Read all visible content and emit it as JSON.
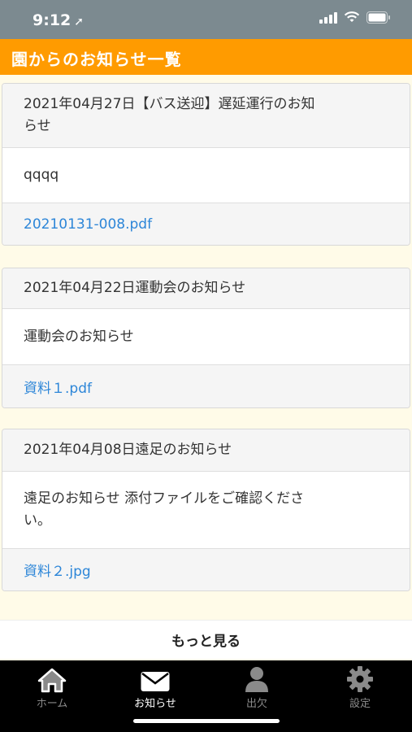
{
  "status_bar": {
    "time": "9:12",
    "location_arrow": "➚"
  },
  "header": {
    "title": "園からのお知らせ一覧"
  },
  "notices": [
    {
      "title_line1": "2021年04月27日【バス送迎】遅延運行のお知",
      "title_line2": "らせ",
      "body_line1": "qqqq",
      "body_line2": "",
      "attachment": "20210131-008.pdf"
    },
    {
      "title_line1": "2021年04月22日運動会のお知らせ",
      "title_line2": "",
      "body_line1": "運動会のお知らせ",
      "body_line2": "",
      "attachment": "資料１.pdf"
    },
    {
      "title_line1": "2021年04月08日遠足のお知らせ",
      "title_line2": "",
      "body_line1": "遠足のお知らせ 添付ファイルをご確認くださ",
      "body_line2": "い。",
      "attachment": "資料２.jpg"
    }
  ],
  "more_button": {
    "label": "もっと見る"
  },
  "tabbar": {
    "items": [
      {
        "label": "ホーム",
        "icon": "home-icon",
        "active": false
      },
      {
        "label": "お知らせ",
        "icon": "envelope-icon",
        "active": true
      },
      {
        "label": "出欠",
        "icon": "person-icon",
        "active": false
      },
      {
        "label": "設定",
        "icon": "gear-icon",
        "active": false
      }
    ]
  },
  "colors": {
    "header": "#ff9b00",
    "status_bar": "#7c8a90",
    "link": "#2d86d8",
    "background": "#fffbe8",
    "tabbar": "#000000"
  }
}
